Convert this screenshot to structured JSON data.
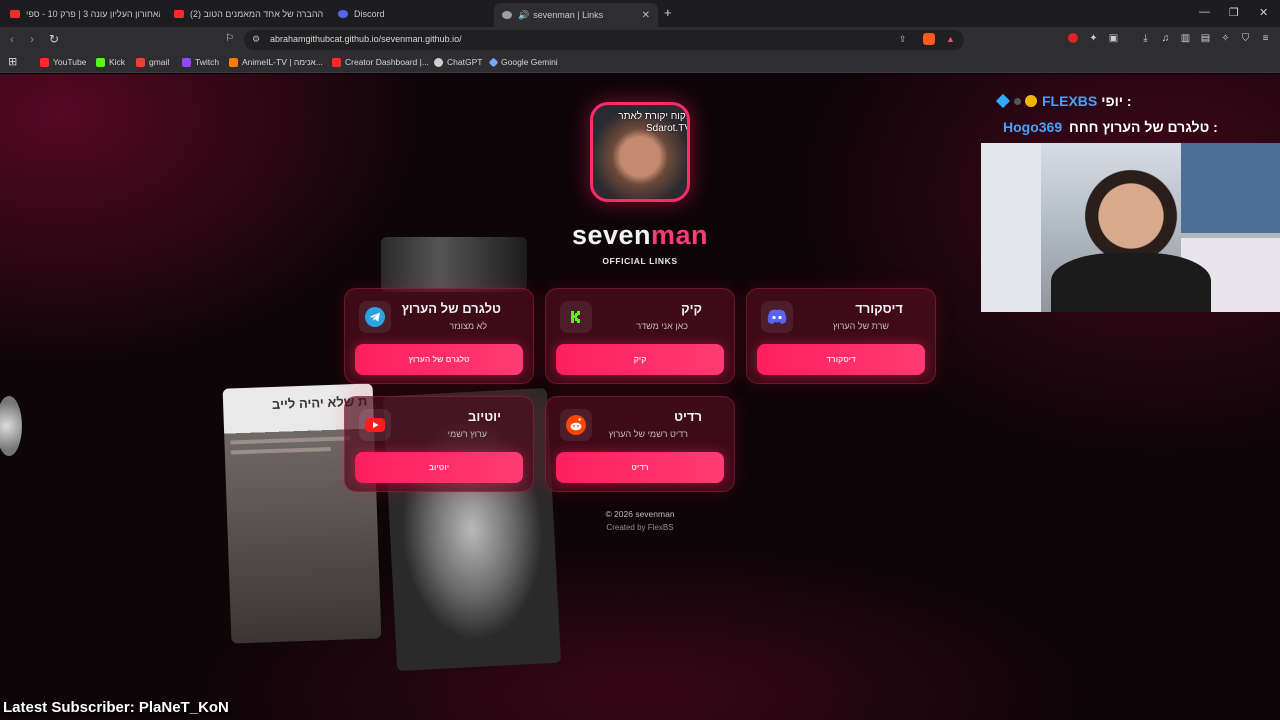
{
  "browser": {
    "tabs": [
      {
        "title": "האחורון העליון עונה 3 | פרק 10 - ספי...",
        "color": "#ff2a2a"
      },
      {
        "title": "(2) זו ההברה של אחד המאמנים הטוב...",
        "color": "#ff2a2a"
      },
      {
        "title": "Discord",
        "color": "#5865f2"
      },
      {
        "title": "sevenman | Links",
        "color": "#9aa0a6"
      }
    ],
    "url": "abrahamgithubcat.github.io/sevenman.github.io/",
    "bookmarks": [
      {
        "label": "YouTube",
        "color": "#ff2a2a"
      },
      {
        "label": "Kick",
        "color": "#53fc18"
      },
      {
        "label": "gmail",
        "color": "#ea4335"
      },
      {
        "label": "Twitch",
        "color": "#9146ff"
      },
      {
        "label": "AnimeIL-TV | אנימה...",
        "color": "#ff7a00"
      },
      {
        "label": "Creator Dashboard |...",
        "color": "#ff2a2a"
      },
      {
        "label": "ChatGPT",
        "color": "#d0d0d0"
      },
      {
        "label": "Google Gemini",
        "color": "#7aa7ff"
      }
    ]
  },
  "page": {
    "avatar_text": "לקוח יקורת לאתר Sdarot.TV",
    "title_a": "seven",
    "title_b": "man",
    "subtitle": "OFFICIAL LINKS",
    "cards": [
      {
        "title": "טלגרם של הערוץ",
        "desc": "לא מצונזר",
        "button": "טלגרם של הערוץ",
        "icon": "telegram-icon"
      },
      {
        "title": "קיק",
        "desc": "כאן אני משדר",
        "button": "קיק",
        "icon": "kick-icon"
      },
      {
        "title": "דיסקורד",
        "desc": "שרת של הערוץ",
        "button": "דיסקורד",
        "icon": "discord-icon"
      },
      {
        "title": "יוטיוב",
        "desc": "ערוץ רשמי",
        "button": "יוטיוב",
        "icon": "youtube-icon"
      },
      {
        "title": "רדיט",
        "desc": "רדיט רשמי של הערוץ",
        "button": "רדיט",
        "icon": "reddit-icon"
      }
    ],
    "footer_copy": "© 2026 sevenman",
    "footer_credit": "Created by FlexBS",
    "photo_caption": "ת שלא יהיה לייב"
  },
  "overlay": {
    "line1_name": "FLEXBS",
    "line1_msg": ": יופי",
    "line2_name": "Hogo369",
    "line2_msg": ": טלגרם של הערוץ חחח",
    "latest_subscriber": "Latest Subscriber: PlaNeT_KoN",
    "colors": {
      "name": "#4aa3ff",
      "text": "#ffffff"
    }
  }
}
